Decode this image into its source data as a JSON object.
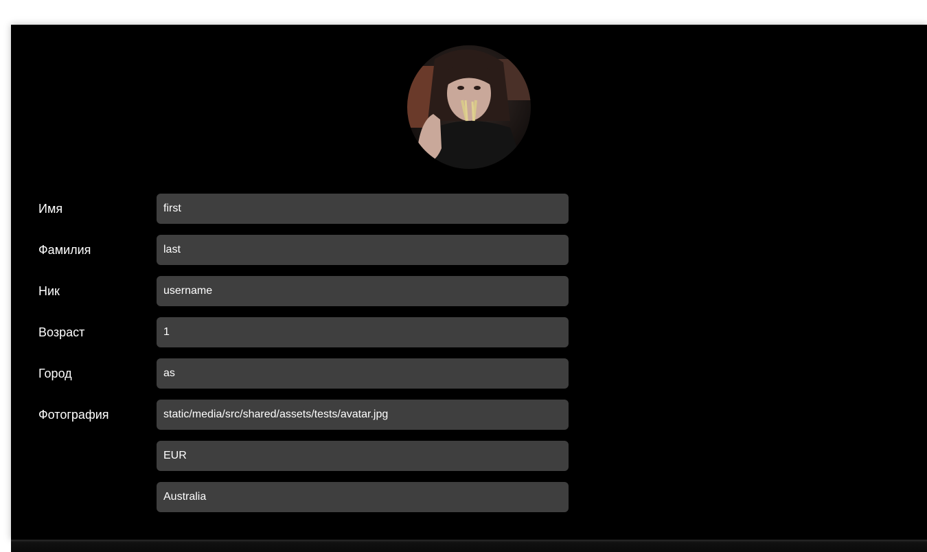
{
  "profile": {
    "avatar_alt": "avatar",
    "fields": [
      {
        "label": "Имя",
        "value": "first"
      },
      {
        "label": "Фамилия",
        "value": "last"
      },
      {
        "label": "Ник",
        "value": "username"
      },
      {
        "label": "Возраст",
        "value": "1"
      },
      {
        "label": "Город",
        "value": "as"
      },
      {
        "label": "Фотография",
        "value": "static/media/src/shared/assets/tests/avatar.jpg"
      }
    ],
    "currency": {
      "value": "EUR"
    },
    "country": {
      "value": "Australia"
    }
  },
  "colors": {
    "card_background": "#000000",
    "field_background": "#3f3f3f",
    "text": "#ffffff"
  }
}
